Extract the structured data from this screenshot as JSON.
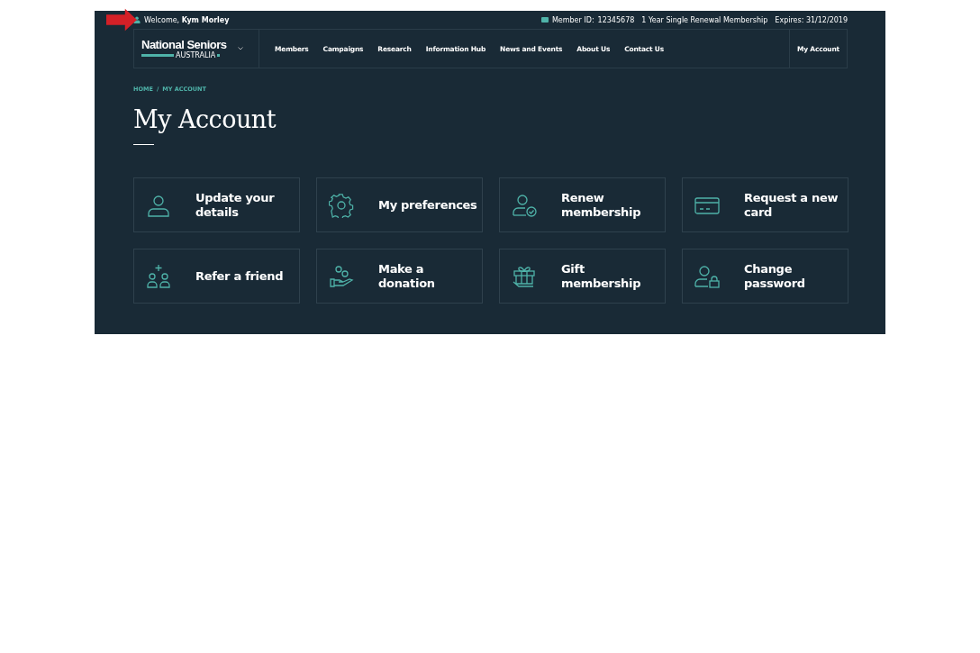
{
  "top_bar": {
    "welcome": "Welcome,",
    "user_name": "Kym Morley",
    "member_id_label": "Member ID:",
    "member_id": "12345678",
    "membership": "1 Year Single Renewal Membership",
    "expires_label": "Expires:",
    "expires": "31/12/2019"
  },
  "logo": {
    "name": "National Seniors",
    "subtitle": "AUSTRALIA"
  },
  "nav": {
    "items": [
      "Members",
      "Campaigns",
      "Research",
      "Information Hub",
      "News and Events",
      "About Us",
      "Contact Us"
    ],
    "account": "My Account"
  },
  "breadcrumb": {
    "items": [
      "HOME",
      "MY ACCOUNT"
    ],
    "separator": "/"
  },
  "title": "My Account",
  "tiles": [
    {
      "kind": "person",
      "label": "Update your details"
    },
    {
      "kind": "gear",
      "label": "My preferences"
    },
    {
      "kind": "person-check",
      "label": "Renew membership"
    },
    {
      "kind": "card",
      "label": "Request a new card"
    },
    {
      "kind": "people-plus",
      "label": "Refer a friend"
    },
    {
      "kind": "hand",
      "label": "Make a donation"
    },
    {
      "kind": "gift",
      "label": "Gift membership"
    },
    {
      "kind": "person-lock",
      "label": "Change password"
    }
  ]
}
